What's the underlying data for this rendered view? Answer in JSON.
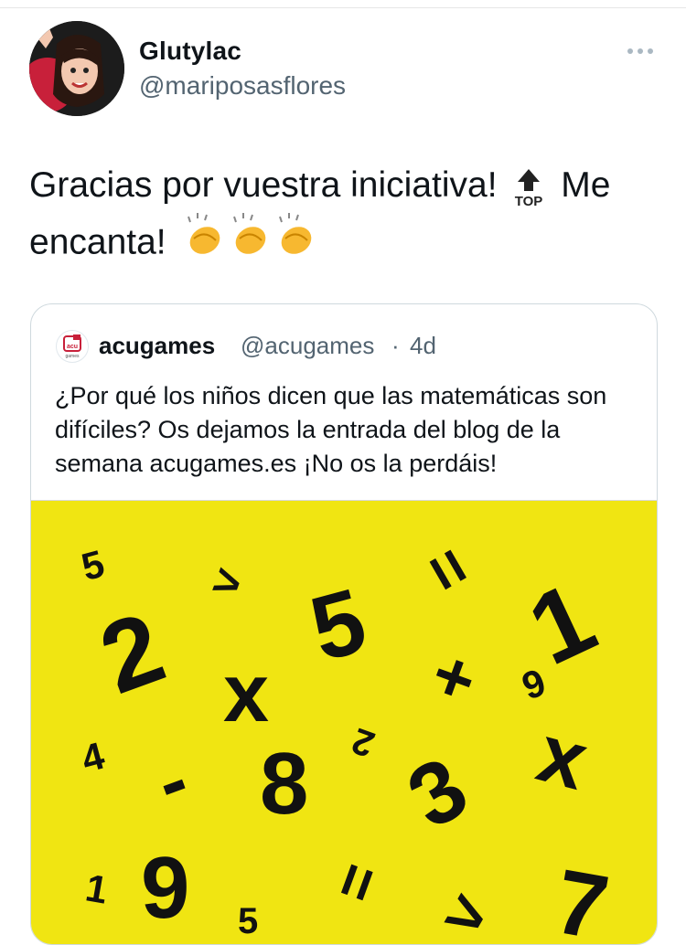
{
  "tweet": {
    "display_name": "Glutylac",
    "handle": "@mariposasflores",
    "text_part1": "Gracias por vuestra iniciativa!",
    "text_part2": "Me",
    "text_part3": "encanta!",
    "top_emoji_label": "TOP",
    "more_icon": "ellipsis-icon"
  },
  "quoted": {
    "name": "acugames",
    "handle": "@acugames",
    "separator": "·",
    "time": "4d",
    "logo_text_top": "acu",
    "logo_text_bottom": "games",
    "text": "¿Por qué los niños dicen que las matemáticas son difíciles? Os dejamos la entrada del blog de la semana acugames.es ¡No os la perdáis!"
  },
  "image_symbols": [
    "5",
    ">",
    "=",
    "1",
    "2",
    "5",
    "x",
    "+",
    "9",
    "4",
    "-",
    "2",
    "8",
    "3",
    "x",
    "1",
    "9",
    "=",
    "7",
    "5",
    ">"
  ],
  "colors": {
    "image_bg": "#f0e512",
    "text": "#0f1419",
    "secondary": "#536471",
    "border": "#cfd9de"
  }
}
